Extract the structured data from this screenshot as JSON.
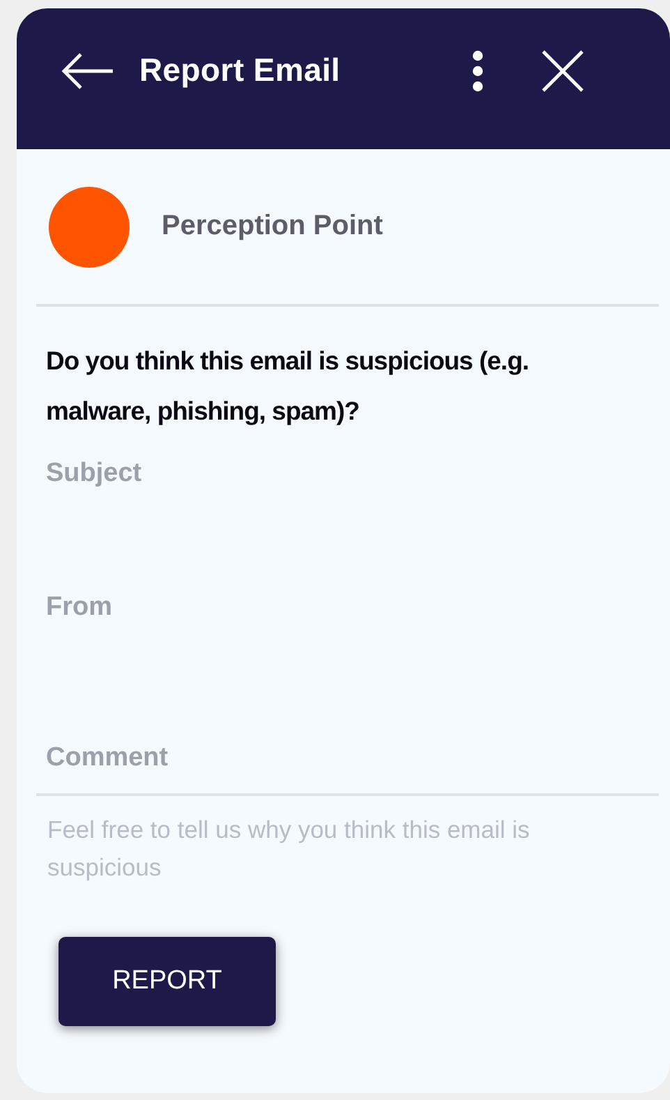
{
  "header": {
    "title": "Report Email"
  },
  "sender": {
    "name": "Perception Point",
    "color": "#ff5500"
  },
  "question": "Do you think this email is suspicious (e.g. malware, phishing, spam)?",
  "fields": [
    {
      "kind": "text",
      "label": "Subject"
    },
    {
      "kind": "text",
      "label": "From"
    },
    {
      "kind": "textarea",
      "label": "Comment",
      "placeholder": "Feel free to tell us why you think this email is suspicious"
    }
  ],
  "buttons": [
    "REPORT"
  ]
}
